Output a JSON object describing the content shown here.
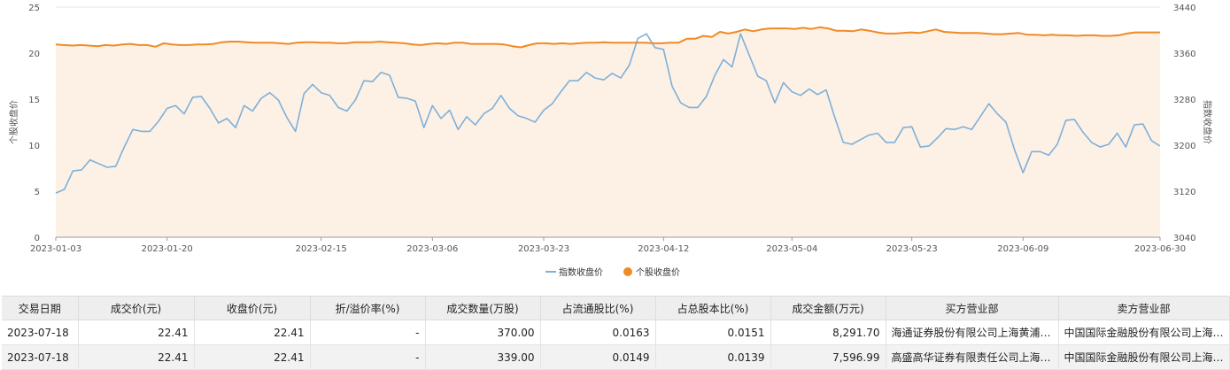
{
  "chart_data": {
    "type": "line",
    "x_ticks": [
      "2023-01-03",
      "2023-01-20",
      "2023-02-15",
      "2023-03-06",
      "2023-03-23",
      "2023-04-12",
      "2023-05-04",
      "2023-05-23",
      "2023-06-09",
      "2023-06-30"
    ],
    "left_axis": {
      "label": "个股收盘价",
      "ticks": [
        "0",
        "5",
        "10",
        "15",
        "20",
        "25"
      ],
      "ylim": [
        0,
        25
      ]
    },
    "right_axis": {
      "label": "指数收盘价",
      "ticks": [
        "3040",
        "3120",
        "3200",
        "3280",
        "3360",
        "3440"
      ],
      "ylim": [
        3040,
        3440
      ]
    },
    "grid": true,
    "legend_position": "bottom-center",
    "series": [
      {
        "name": "指数收盘价",
        "axis": "left",
        "color": "#7eb0d8",
        "style": "line",
        "values": [
          4.8,
          5.2,
          7.2,
          7.3,
          8.4,
          8.0,
          7.6,
          7.7,
          9.8,
          11.7,
          11.5,
          11.5,
          12.6,
          14.0,
          14.3,
          13.4,
          15.2,
          15.3,
          14.0,
          12.4,
          12.9,
          11.9,
          14.3,
          13.7,
          15.1,
          15.7,
          14.9,
          13.0,
          11.5,
          15.6,
          16.6,
          15.7,
          15.4,
          14.1,
          13.7,
          14.9,
          17.0,
          16.9,
          17.9,
          17.6,
          15.2,
          15.1,
          14.8,
          11.9,
          14.3,
          12.9,
          13.8,
          11.7,
          13.1,
          12.2,
          13.4,
          14.0,
          15.4,
          14.0,
          13.2,
          12.9,
          12.5,
          13.8,
          14.5,
          15.8,
          17.0,
          17.0,
          17.9,
          17.3,
          17.1,
          17.8,
          17.3,
          18.7,
          21.6,
          22.1,
          20.6,
          20.4,
          16.4,
          14.6,
          14.1,
          14.1,
          15.3,
          17.6,
          19.3,
          18.5,
          22.1,
          19.8,
          17.5,
          17.0,
          14.6,
          16.8,
          15.8,
          15.4,
          16.1,
          15.5,
          16.0,
          13.0,
          10.3,
          10.1,
          10.6,
          11.1,
          11.3,
          10.3,
          10.3,
          11.9,
          12.0,
          9.8,
          9.9,
          10.8,
          11.8,
          11.7,
          12.0,
          11.7,
          13.1,
          14.5,
          13.4,
          12.5,
          9.5,
          7.0,
          9.3,
          9.3,
          8.9,
          10.1,
          12.7,
          12.8,
          11.4,
          10.3,
          9.8,
          10.1,
          11.3,
          9.8,
          12.2,
          12.3,
          10.5,
          9.9
        ]
      },
      {
        "name": "个股收盘价",
        "axis": "right",
        "color": "#f08a24",
        "style": "area",
        "values": [
          3375,
          3374,
          3373,
          3374,
          3373,
          3372,
          3374,
          3373,
          3375,
          3376,
          3374,
          3374,
          3371,
          3377,
          3375,
          3374,
          3374,
          3375,
          3375,
          3376,
          3379,
          3380,
          3380,
          3379,
          3378,
          3378,
          3378,
          3377,
          3376,
          3378,
          3379,
          3379,
          3378,
          3378,
          3377,
          3377,
          3379,
          3379,
          3379,
          3380,
          3379,
          3378,
          3377,
          3375,
          3374,
          3376,
          3377,
          3376,
          3378,
          3378,
          3376,
          3376,
          3376,
          3376,
          3375,
          3372,
          3370,
          3374,
          3377,
          3377,
          3376,
          3377,
          3376,
          3377,
          3378,
          3378,
          3379,
          3378,
          3378,
          3378,
          3378,
          3378,
          3377,
          3377,
          3378,
          3378,
          3385,
          3385,
          3390,
          3388,
          3397,
          3394,
          3397,
          3401,
          3398,
          3401,
          3403,
          3403,
          3403,
          3402,
          3404,
          3402,
          3405,
          3403,
          3399,
          3399,
          3398,
          3401,
          3399,
          3396,
          3394,
          3394,
          3395,
          3396,
          3395,
          3398,
          3401,
          3397,
          3396,
          3395,
          3395,
          3395,
          3394,
          3393,
          3393,
          3394,
          3395,
          3392,
          3392,
          3391,
          3392,
          3391,
          3391,
          3390,
          3391,
          3391,
          3390,
          3390,
          3391,
          3394,
          3396,
          3396,
          3396,
          3396
        ]
      }
    ]
  },
  "table": {
    "headers": [
      "交易日期",
      "成交价(元)",
      "收盘价(元)",
      "折/溢价率(%)",
      "成交数量(万股)",
      "占流通股比(%)",
      "占总股本比(%)",
      "成交金额(万元)",
      "买方营业部",
      "卖方营业部"
    ],
    "rows": [
      [
        "2023-07-18",
        "22.41",
        "22.41",
        "-",
        "370.00",
        "0.0163",
        "0.0151",
        "8,291.70",
        "海通证券股份有限公司上海黄浦区…",
        "中国国际金融股份有限公司上海…"
      ],
      [
        "2023-07-18",
        "22.41",
        "22.41",
        "-",
        "339.00",
        "0.0149",
        "0.0139",
        "7,596.99",
        "高盛高华证券有限责任公司上海浦…",
        "中国国际金融股份有限公司上海…"
      ]
    ]
  }
}
